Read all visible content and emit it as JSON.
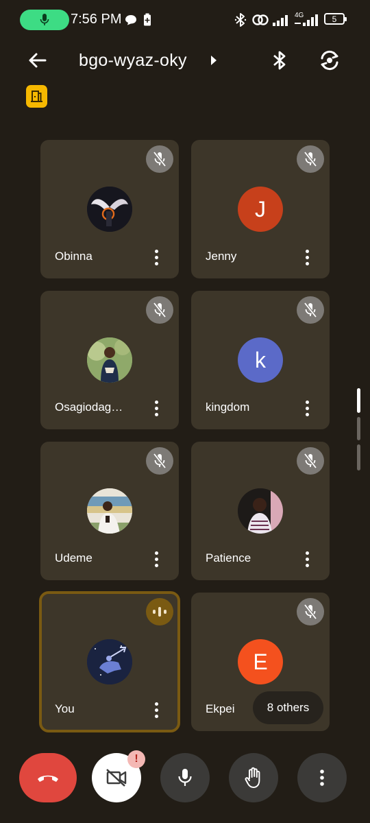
{
  "status_bar": {
    "time": "7:56 PM",
    "network_label": "4G",
    "battery": "5",
    "icons": [
      "mic-icon",
      "chat-bubble-icon",
      "battery-saver-icon",
      "bluetooth-icon",
      "hotspot-icon",
      "signal-icon",
      "signal-4g-icon",
      "battery-icon"
    ]
  },
  "top_bar": {
    "meeting_code": "bgo-wyaz-oky",
    "icons": [
      "back-arrow-icon",
      "chevron-right-icon",
      "bluetooth-icon",
      "camera-flip-icon"
    ],
    "host_badge_icon": "host-controls-icon"
  },
  "participants": [
    {
      "name": "Obinna",
      "muted": true,
      "avatar": "photo",
      "avatar_color": "#1c1c24"
    },
    {
      "name": "Jenny",
      "muted": true,
      "avatar": "J",
      "avatar_color": "#c7401b"
    },
    {
      "name": "Osagiodag…",
      "muted": true,
      "avatar": "photo",
      "avatar_color": "#8fa96a"
    },
    {
      "name": "kingdom",
      "muted": true,
      "avatar": "k",
      "avatar_color": "#5b6ac8"
    },
    {
      "name": "Udeme",
      "muted": true,
      "avatar": "photo",
      "avatar_color": "#d8d2c4"
    },
    {
      "name": "Patience",
      "muted": true,
      "avatar": "photo",
      "avatar_color": "#2a2420"
    },
    {
      "name": "You",
      "muted": false,
      "speaking": true,
      "avatar": "photo",
      "avatar_color": "#1a2340"
    },
    {
      "name": "Ekpei",
      "muted": true,
      "avatar": "E",
      "avatar_color": "#f4511e"
    }
  ],
  "others_chip": "8 others",
  "controls": {
    "icons": [
      "end-call-icon",
      "camera-off-icon",
      "mic-icon",
      "raise-hand-icon",
      "more-vert-icon"
    ],
    "camera_alert": "!",
    "colors": {
      "end_call": "#e0473e",
      "camera": "#ffffff",
      "secondary": "#3b3a38"
    }
  }
}
